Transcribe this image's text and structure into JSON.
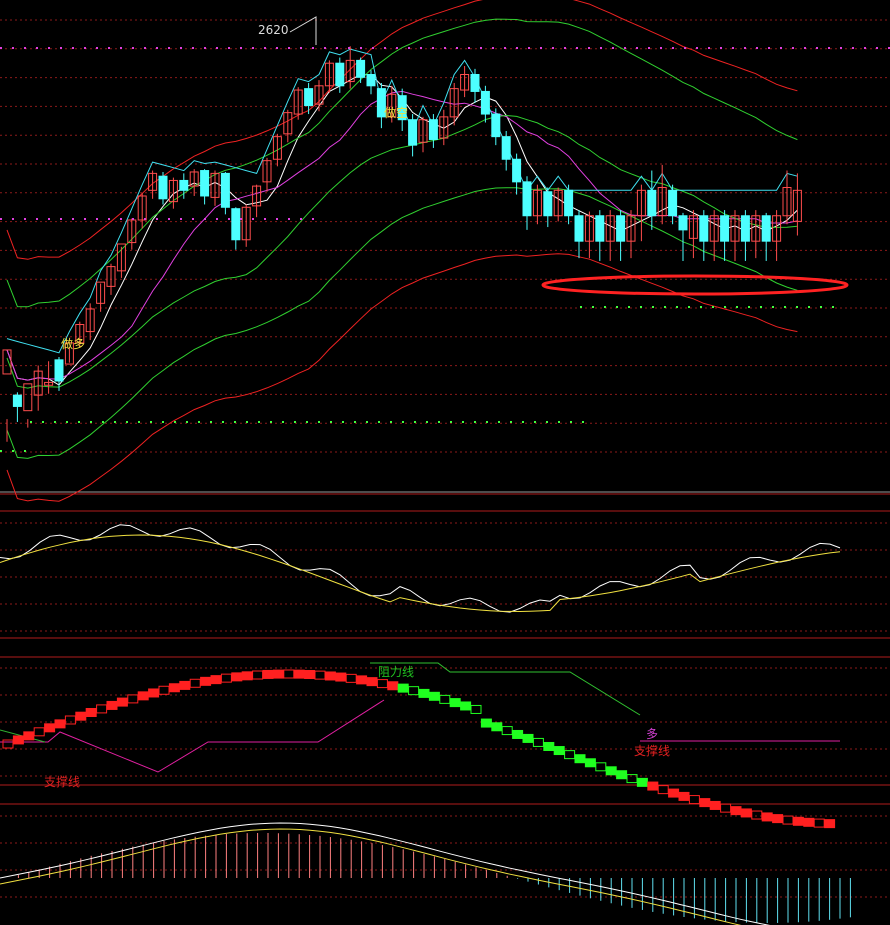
{
  "chart_data": {
    "type": "candlestick",
    "panels": [
      {
        "name": "price",
        "annotations": {
          "peak_label": "2620",
          "short_signal": "做空",
          "long_signal": "做多"
        },
        "candles": [
          [
            2388,
            2405,
            2356,
            2340
          ],
          [
            2373,
            2365,
            2375,
            2354
          ],
          [
            2362,
            2381,
            2356,
            2350
          ],
          [
            2373,
            2390,
            2394,
            2362
          ],
          [
            2380,
            2382,
            2397,
            2374
          ],
          [
            2398,
            2383,
            2400,
            2376
          ],
          [
            2395,
            2410,
            2407,
            2396
          ],
          [
            2410,
            2423,
            2425,
            2407
          ],
          [
            2418,
            2434,
            2438,
            2412
          ],
          [
            2438,
            2453,
            2452,
            2432
          ],
          [
            2450,
            2464,
            2466,
            2444
          ],
          [
            2461,
            2480,
            2478,
            2456
          ],
          [
            2481,
            2497,
            2498,
            2476
          ],
          [
            2497,
            2514,
            2516,
            2491
          ],
          [
            2518,
            2530,
            2532,
            2512
          ],
          [
            2528,
            2512,
            2531,
            2508
          ],
          [
            2510,
            2525,
            2527,
            2505
          ],
          [
            2525,
            2518,
            2530,
            2512
          ],
          [
            2521,
            2531,
            2533,
            2514
          ],
          [
            2532,
            2514,
            2533,
            2508
          ],
          [
            2513,
            2530,
            2532,
            2507
          ],
          [
            2530,
            2506,
            2531,
            2501
          ],
          [
            2505,
            2483,
            2506,
            2476
          ],
          [
            2483,
            2506,
            2508,
            2478
          ],
          [
            2507,
            2521,
            2522,
            2499
          ],
          [
            2524,
            2539,
            2541,
            2517
          ],
          [
            2540,
            2556,
            2558,
            2535
          ],
          [
            2558,
            2573,
            2575,
            2552
          ],
          [
            2572,
            2589,
            2591,
            2568
          ],
          [
            2590,
            2578,
            2594,
            2572
          ],
          [
            2579,
            2592,
            2596,
            2574
          ],
          [
            2592,
            2608,
            2610,
            2587
          ],
          [
            2608,
            2592,
            2612,
            2587
          ],
          [
            2595,
            2610,
            2620,
            2590
          ],
          [
            2610,
            2598,
            2612,
            2594
          ],
          [
            2600,
            2592,
            2603,
            2586
          ],
          [
            2590,
            2570,
            2594,
            2562
          ],
          [
            2570,
            2586,
            2592,
            2566
          ],
          [
            2585,
            2568,
            2590,
            2560
          ],
          [
            2568,
            2550,
            2572,
            2542
          ],
          [
            2552,
            2568,
            2570,
            2545
          ],
          [
            2568,
            2554,
            2572,
            2548
          ],
          [
            2555,
            2570,
            2575,
            2550
          ],
          [
            2570,
            2590,
            2594,
            2564
          ],
          [
            2589,
            2600,
            2606,
            2584
          ],
          [
            2600,
            2588,
            2604,
            2580
          ],
          [
            2588,
            2572,
            2592,
            2566
          ],
          [
            2572,
            2556,
            2576,
            2550
          ],
          [
            2556,
            2540,
            2560,
            2532
          ],
          [
            2540,
            2524,
            2544,
            2515
          ],
          [
            2524,
            2500,
            2528,
            2490
          ],
          [
            2500,
            2518,
            2522,
            2494
          ],
          [
            2517,
            2500,
            2520,
            2492
          ],
          [
            2500,
            2518,
            2520,
            2496
          ],
          [
            2518,
            2500,
            2522,
            2494
          ],
          [
            2500,
            2482,
            2504,
            2470
          ],
          [
            2482,
            2500,
            2503,
            2470
          ],
          [
            2500,
            2482,
            2504,
            2468
          ],
          [
            2482,
            2500,
            2504,
            2468
          ],
          [
            2500,
            2482,
            2504,
            2468
          ],
          [
            2482,
            2500,
            2504,
            2470
          ],
          [
            2500,
            2518,
            2522,
            2482
          ],
          [
            2518,
            2500,
            2532,
            2490
          ],
          [
            2500,
            2520,
            2536,
            2494
          ],
          [
            2518,
            2500,
            2522,
            2494
          ],
          [
            2500,
            2490,
            2502,
            2468
          ],
          [
            2484,
            2500,
            2504,
            2470
          ],
          [
            2500,
            2482,
            2504,
            2468
          ],
          [
            2482,
            2500,
            2504,
            2468
          ],
          [
            2500,
            2482,
            2504,
            2468
          ],
          [
            2482,
            2500,
            2504,
            2468
          ],
          [
            2500,
            2482,
            2504,
            2468
          ],
          [
            2482,
            2500,
            2504,
            2470
          ],
          [
            2500,
            2482,
            2502,
            2468
          ],
          [
            2482,
            2500,
            2504,
            2468
          ],
          [
            2500,
            2520,
            2532,
            2494
          ],
          [
            2496,
            2518,
            2530,
            2486
          ]
        ],
        "ylim": [
          2320,
          2640
        ]
      },
      {
        "name": "oscillator_1"
      },
      {
        "name": "oscillator_2",
        "annotations": {
          "resistance": "阻力线",
          "support_left": "支撑线",
          "support_right": "支撑线",
          "long": "多"
        }
      },
      {
        "name": "macd"
      }
    ]
  },
  "colors": {
    "background": "#000000",
    "up": "#ff4d4d",
    "down": "#4dffff",
    "grid": "#8b1a1a",
    "ma_white": "#ffffff",
    "ma_magenta": "#e040e0",
    "ma_green": "#30d030",
    "band_red": "#ee2222",
    "trail_cyan": "#40e0f0",
    "highlight_ellipse": "#ff2222"
  }
}
